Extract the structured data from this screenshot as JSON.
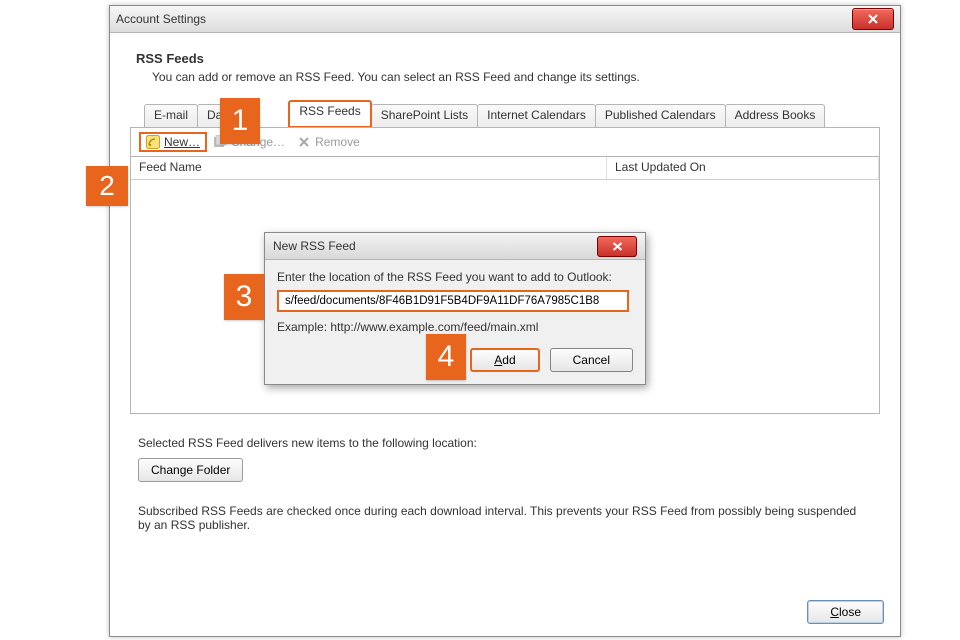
{
  "window": {
    "title": "Account Settings",
    "section_title": "RSS Feeds",
    "section_desc": "You can add or remove an RSS Feed. You can select an RSS Feed and change its settings."
  },
  "tabs": {
    "email": "E-mail",
    "data": "Data",
    "rss": "RSS Feeds",
    "sharepoint": "SharePoint Lists",
    "ical": "Internet Calendars",
    "pubcal": "Published Calendars",
    "addr": "Address Books"
  },
  "toolbar": {
    "new": "New…",
    "change": "Change…",
    "remove": "Remove"
  },
  "columns": {
    "feed_name": "Feed Name",
    "last_updated": "Last Updated On"
  },
  "lower": {
    "delivers": "Selected RSS Feed delivers new items to the following location:",
    "change_folder": "Change Folder",
    "interval_note": "Subscribed RSS Feeds are checked once during each download interval. This prevents your RSS Feed from possibly being suspended by an RSS publisher."
  },
  "footer": {
    "close": "Close"
  },
  "modal": {
    "title": "New RSS Feed",
    "prompt": "Enter the location of the RSS Feed you want to add to Outlook:",
    "url_value": "s/feed/documents/8F46B1D91F5B4DF9A11DF76A7985C1B8",
    "example": "Example: http://www.example.com/feed/main.xml",
    "add": "Add",
    "cancel": "Cancel"
  },
  "callouts": {
    "n1": "1",
    "n2": "2",
    "n3": "3",
    "n4": "4"
  }
}
